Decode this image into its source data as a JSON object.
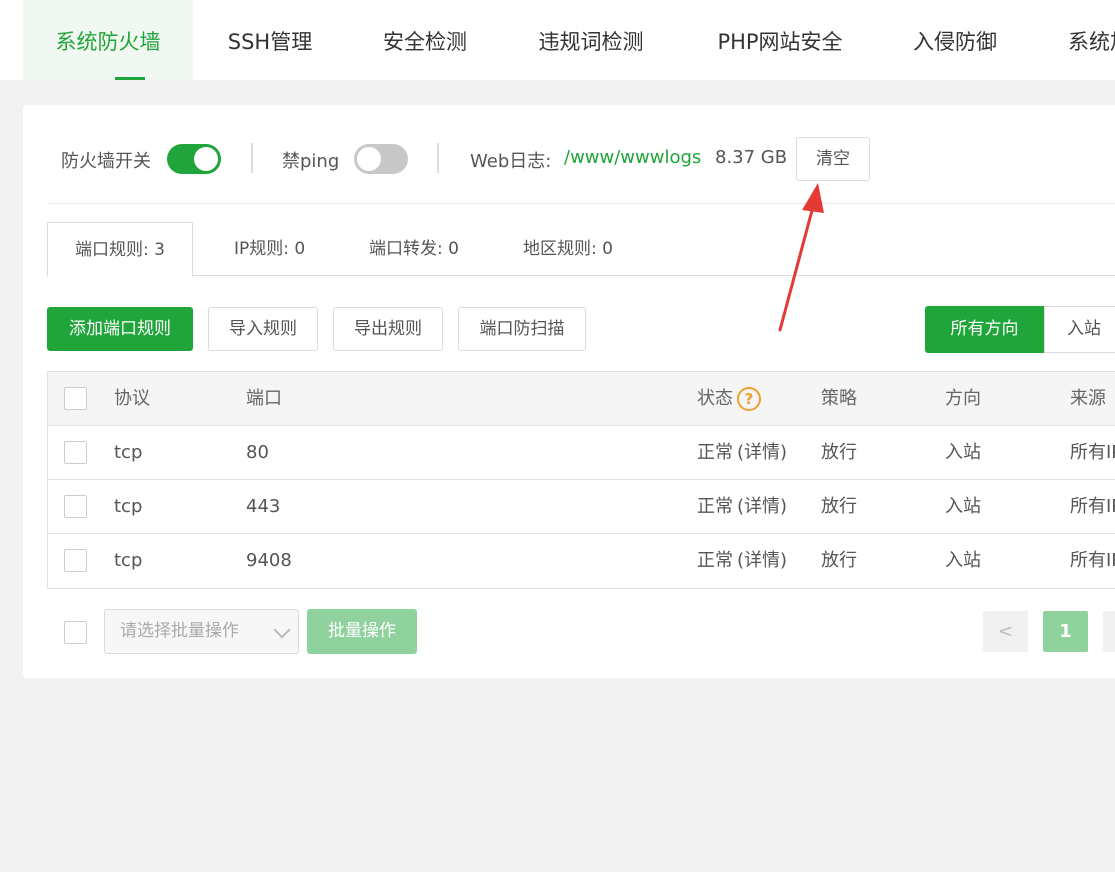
{
  "topnav": {
    "tabs": [
      {
        "label": "系统防火墙"
      },
      {
        "label": "SSH管理"
      },
      {
        "label": "安全检测"
      },
      {
        "label": "违规词检测"
      },
      {
        "label": "PHP网站安全"
      },
      {
        "label": "入侵防御"
      },
      {
        "label": "系统加"
      }
    ]
  },
  "switches": {
    "firewall_label": "防火墙开关",
    "firewall_on": true,
    "ping_label": "禁ping",
    "ping_on": false,
    "weblog_label": "Web日志:",
    "weblog_path": "/www/wwwlogs",
    "weblog_size": "8.37 GB",
    "clear_label": "清空"
  },
  "subtabs": [
    {
      "label": "端口规则: 3"
    },
    {
      "label": "IP规则: 0"
    },
    {
      "label": "端口转发: 0"
    },
    {
      "label": "地区规则: 0"
    }
  ],
  "toolbar": {
    "add_label": "添加端口规则",
    "import_label": "导入规则",
    "export_label": "导出规则",
    "scan_label": "端口防扫描",
    "direction_all": "所有方向",
    "direction_in": "入站"
  },
  "table": {
    "headers": {
      "protocol": "协议",
      "port": "端口",
      "status": "状态",
      "policy": "策略",
      "direction": "方向",
      "source": "来源"
    },
    "help_glyph": "?",
    "rows": [
      {
        "protocol": "tcp",
        "port": "80",
        "status": "正常",
        "detail": "(详情)",
        "policy": "放行",
        "direction": "入站",
        "source": "所有IP"
      },
      {
        "protocol": "tcp",
        "port": "443",
        "status": "正常",
        "detail": "(详情)",
        "policy": "放行",
        "direction": "入站",
        "source": "所有IP"
      },
      {
        "protocol": "tcp",
        "port": "9408",
        "status": "正常",
        "detail": "(详情)",
        "policy": "放行",
        "direction": "入站",
        "source": "所有IP"
      }
    ]
  },
  "footer": {
    "batch_placeholder": "请选择批量操作",
    "batch_button": "批量操作",
    "prev_glyph": "<",
    "page": "1"
  },
  "colors": {
    "accent": "#20a53a",
    "annotation": "#e53935"
  }
}
